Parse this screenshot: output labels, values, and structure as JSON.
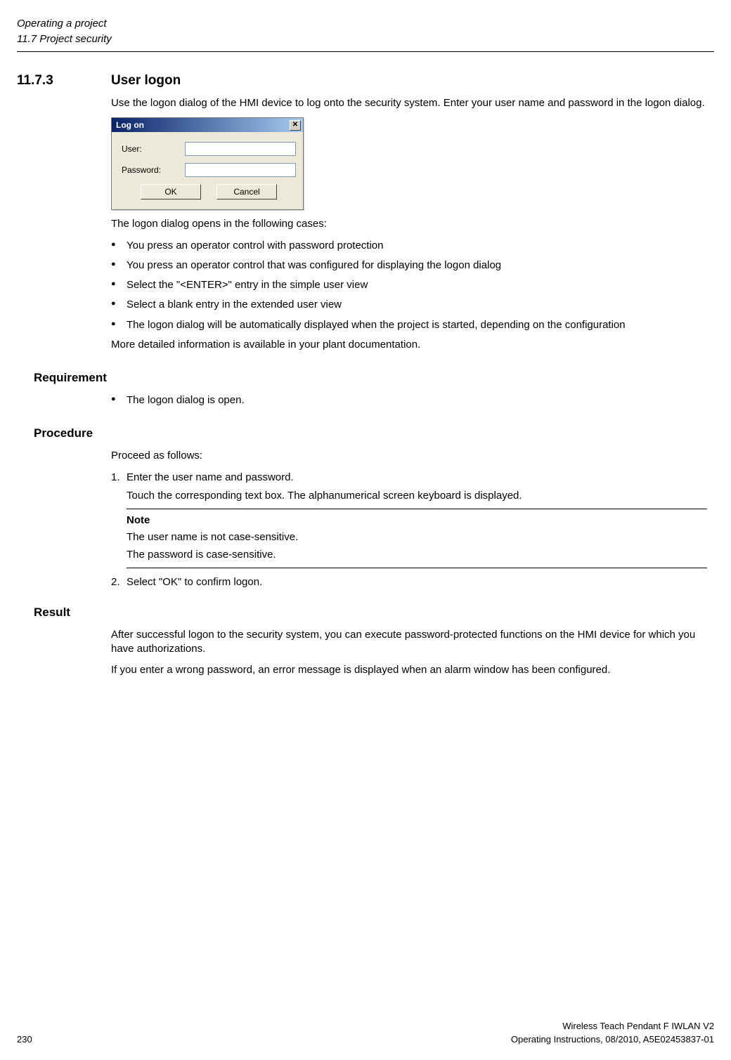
{
  "header": {
    "chapter": "Operating a project",
    "section": "11.7 Project security"
  },
  "section": {
    "number": "11.7.3",
    "title": "User logon"
  },
  "intro": "Use the logon dialog of the HMI device to log onto the security system. Enter your user name and password in the logon dialog.",
  "dialog": {
    "title": "Log on",
    "user_label": "User:",
    "password_label": "Password:",
    "ok": "OK",
    "cancel": "Cancel"
  },
  "after_dialog": "The logon dialog opens in the following cases:",
  "bullets": [
    "You press an operator control with password protection",
    "You press an operator control that was configured for displaying the logon dialog",
    "Select the \"<ENTER>\" entry in the simple user view",
    "Select a blank entry in the extended user view",
    "The logon dialog will be automatically displayed when the project is started, depending on the configuration"
  ],
  "more_info": "More detailed information is available in your plant documentation.",
  "requirement": {
    "heading": "Requirement",
    "items": [
      "The logon dialog is open."
    ]
  },
  "procedure": {
    "heading": "Procedure",
    "lead": "Proceed as follows:",
    "step1_main": "Enter the user name and password.",
    "step1_sub": "Touch the corresponding text box. The alphanumerical screen keyboard is displayed.",
    "note_title": "Note",
    "note_line1": "The user name is not case-sensitive.",
    "note_line2": "The password is case-sensitive.",
    "step2": "Select \"OK\" to confirm logon."
  },
  "result": {
    "heading": "Result",
    "p1": "After successful logon to the security system, you can execute password-protected functions on the HMI device for which you have authorizations.",
    "p2": "If you enter a wrong password, an error message is displayed when an alarm window has been configured."
  },
  "footer": {
    "product": "Wireless Teach Pendant F IWLAN V2",
    "page": "230",
    "docinfo": "Operating Instructions, 08/2010, A5E02453837-01"
  }
}
